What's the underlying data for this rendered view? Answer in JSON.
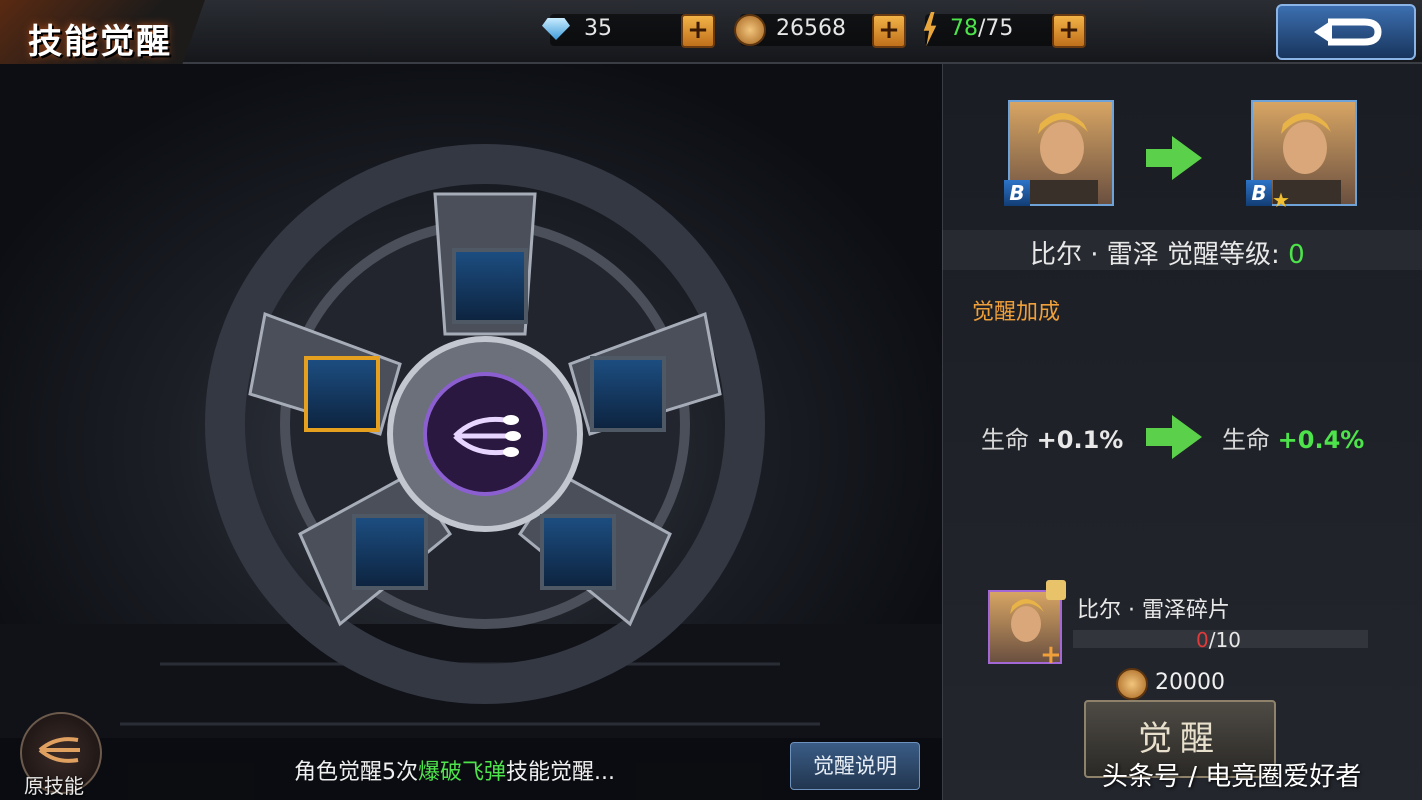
{
  "header": {
    "title": "技能觉醒",
    "diamonds": "35",
    "gold": "26568",
    "stamina_current": "78",
    "stamina_max": "/75",
    "plus": "+"
  },
  "hero": {
    "name": "比尔 · 雷泽 觉醒等级: ",
    "level": "0",
    "rank": "B"
  },
  "bonus": {
    "title": "觉醒加成",
    "stat_label": "生命",
    "before": "+0.1%",
    "after": "+0.4%"
  },
  "shard": {
    "name": "比尔 · 雷泽碎片",
    "owned": "0",
    "required": "/10",
    "cost": "20000"
  },
  "buttons": {
    "awaken": "觉醒",
    "explain": "觉醒说明",
    "original_skill": "原技能"
  },
  "hint": {
    "prefix": "角色觉醒5次",
    "skill": "爆破飞弹",
    "suffix": "技能觉醒..."
  },
  "watermark": "头条号 / 电竞圈爱好者",
  "colors": {
    "accent_green": "#4de34a",
    "accent_orange": "#f0a03a",
    "button_blue": "#3a5c86"
  }
}
